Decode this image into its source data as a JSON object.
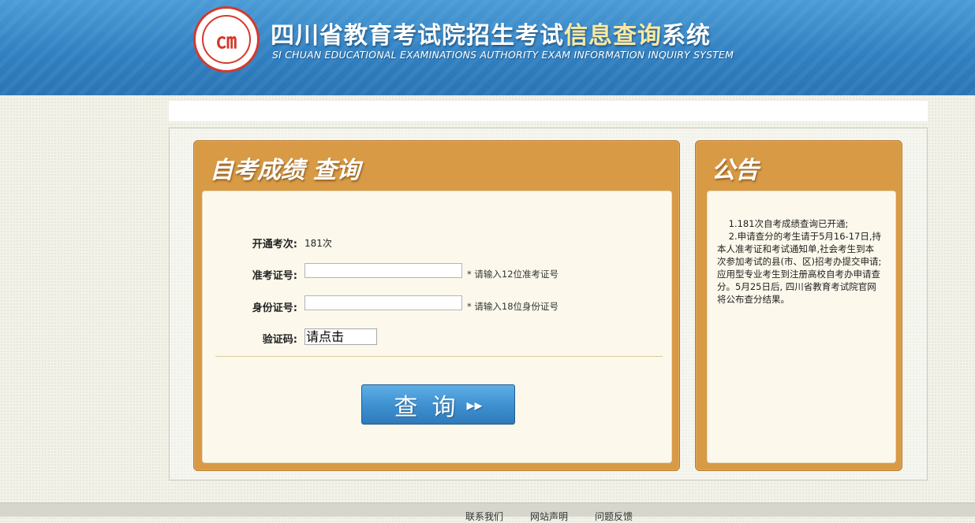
{
  "header": {
    "logo_text": "四川省教育考试院",
    "title_main": "四川省教育考试院招生考试",
    "title_highlight": "信息查询",
    "title_suffix": "系统",
    "title_en": "SI CHUAN EDUCATIONAL EXAMINATIONS AUTHORITY EXAM INFORMATION INQUIRY SYSTEM"
  },
  "query": {
    "title": "自考成绩  查询",
    "opened_label": "开通考次:",
    "opened_value": "181次",
    "ticket_label": "准考证号:",
    "ticket_value": "",
    "ticket_hint": "* 请输入12位准考证号",
    "id_label": "身份证号:",
    "id_value": "",
    "id_hint": "* 请输入18位身份证号",
    "captcha_label": "验证码:",
    "captcha_text": "请点击",
    "submit_label": "查询",
    "submit_arrow": "▸▸"
  },
  "notice": {
    "title": "公告",
    "text": "    1.181次自考成绩查询已开通;\n    2.申请查分的考生请于5月16-17日,持本人准考证和考试通知单,社会考生到本次参加考试的县(市、区)招考办提交申请;应用型专业考生到注册高校自考办申请查分。5月25日后, 四川省教育考试院官网将公布查分结果。"
  },
  "footer": {
    "links": [
      "联系我们",
      "网站声明",
      "问题反馈"
    ]
  },
  "colors": {
    "header_blue": "#2f7fc1",
    "panel_orange": "#d89a45",
    "panel_body": "#fcf9ec",
    "button_blue": "#3d8fcf"
  }
}
